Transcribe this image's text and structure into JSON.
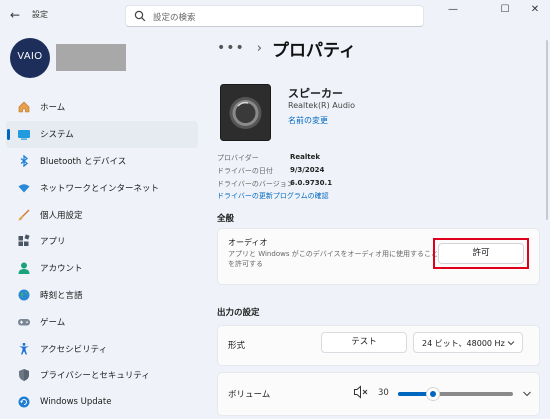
{
  "window": {
    "title": "設定",
    "back_icon": "←",
    "minimize": "—",
    "maximize": "☐",
    "close": "✕"
  },
  "search": {
    "placeholder": "設定の検索"
  },
  "profile": {
    "logo_text": "VAIO"
  },
  "sidebar": {
    "items": [
      {
        "label": "ホーム",
        "icon": "home-icon"
      },
      {
        "label": "システム",
        "icon": "system-icon",
        "active": true
      },
      {
        "label": "Bluetooth とデバイス",
        "icon": "bluetooth-icon"
      },
      {
        "label": "ネットワークとインターネット",
        "icon": "wifi-icon"
      },
      {
        "label": "個人用設定",
        "icon": "brush-icon"
      },
      {
        "label": "アプリ",
        "icon": "apps-icon"
      },
      {
        "label": "アカウント",
        "icon": "account-icon"
      },
      {
        "label": "時刻と言語",
        "icon": "globe-icon"
      },
      {
        "label": "ゲーム",
        "icon": "gamepad-icon"
      },
      {
        "label": "アクセシビリティ",
        "icon": "accessibility-icon"
      },
      {
        "label": "プライバシーとセキュリティ",
        "icon": "shield-icon"
      },
      {
        "label": "Windows Update",
        "icon": "update-icon"
      }
    ]
  },
  "breadcrumb": {
    "more": "•••",
    "separator": "›",
    "title": "プロパティ"
  },
  "device": {
    "name": "スピーカー",
    "driver": "Realtek(R) Audio",
    "rename": "名前の変更"
  },
  "driver_info": {
    "rows": [
      {
        "label": "プロバイダー",
        "value": "Realtek"
      },
      {
        "label": "ドライバーの日付",
        "value": "9/3/2024"
      },
      {
        "label": "ドライバーのバージョン",
        "value": "6.0.9730.1"
      }
    ],
    "update_link": "ドライバーの更新プログラムの確認"
  },
  "general": {
    "title": "全般",
    "audio_title": "オーディオ",
    "audio_desc": "アプリと Windows がこのデバイスをオーディオ用に使用することを許可する",
    "allow_label": "許可"
  },
  "output": {
    "title": "出力の設定",
    "format_label": "形式",
    "test_label": "テスト",
    "format_value": "24 ビット、48000 Hz",
    "volume_label": "ボリューム",
    "volume_value": "30",
    "volume_fraction": 0.3
  },
  "colors": {
    "accent": "#0067c0",
    "highlight": "#e0001b"
  }
}
